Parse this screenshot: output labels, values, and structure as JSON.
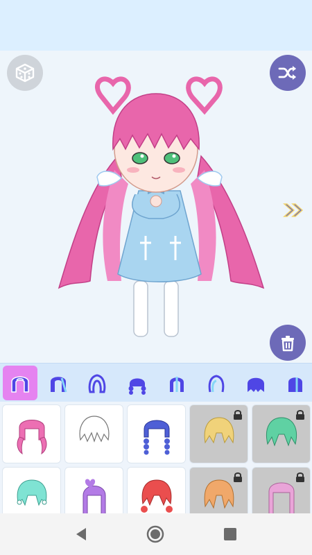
{
  "app": {
    "accent_color": "#6d6ab8",
    "active_tab_color": "#e583f0",
    "top_bar_color": "#dcefff"
  },
  "stage": {
    "buttons": {
      "randomize_icon": "dice-icon",
      "shuffle_icon": "shuffle-icon",
      "next_icon": "double-chevron-right-icon",
      "delete_icon": "trash-icon"
    }
  },
  "categories": [
    {
      "icon": "hair-style-1-icon",
      "active": true
    },
    {
      "icon": "hair-style-2-icon",
      "active": false
    },
    {
      "icon": "hair-style-3-icon",
      "active": false
    },
    {
      "icon": "hair-style-4-icon",
      "active": false
    },
    {
      "icon": "hair-style-5-icon",
      "active": false
    },
    {
      "icon": "hair-style-6-icon",
      "active": false
    },
    {
      "icon": "hair-style-7-icon",
      "active": false
    },
    {
      "icon": "hair-style-8-icon",
      "active": false
    }
  ],
  "hair_items": [
    {
      "color": "#ec6fb3",
      "locked": false
    },
    {
      "color": "#ffffff",
      "locked": false
    },
    {
      "color": "#4e5fd6",
      "locked": false
    },
    {
      "color": "#f0d27a",
      "locked": true
    },
    {
      "color": "#5fd1a3",
      "locked": true
    },
    {
      "color": "#7fe3d3",
      "locked": false
    },
    {
      "color": "#b37be6",
      "locked": false
    },
    {
      "color": "#ea4e4e",
      "locked": false
    },
    {
      "color": "#f0a86a",
      "locked": true
    },
    {
      "color": "#e9a4d8",
      "locked": true
    }
  ],
  "navigation": {
    "back_icon": "back-triangle-icon",
    "home_icon": "home-circle-icon",
    "recents_icon": "recents-square-icon"
  }
}
